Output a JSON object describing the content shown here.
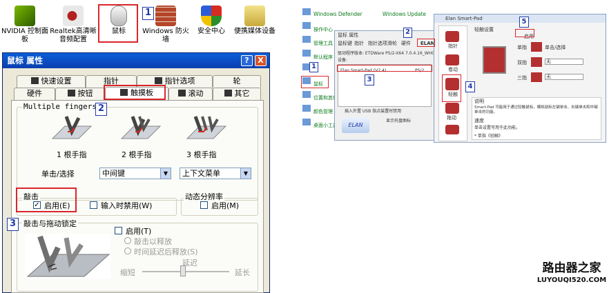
{
  "control_panel": {
    "items": [
      {
        "label": "NVIDIA 控制面板",
        "icon": "nvidia-icon"
      },
      {
        "label": "Realtek高清晰音频配置",
        "icon": "speaker-icon"
      },
      {
        "label": "鼠标",
        "icon": "mouse-icon"
      },
      {
        "label": "Windows 防火墙",
        "icon": "firewall-icon"
      },
      {
        "label": "安全中心",
        "icon": "shield-icon"
      },
      {
        "label": "便携媒体设备",
        "icon": "media-device-icon"
      }
    ]
  },
  "mouse_dialog": {
    "title": "鼠标 属性",
    "help_button": "?",
    "close_button": "X",
    "tabs_row1": [
      "快速设置",
      "指针",
      "指针选项",
      "轮"
    ],
    "tabs_row2": [
      "硬件",
      "按钮",
      "触摸板",
      "滚动",
      "其它"
    ],
    "multiple_fingers": {
      "title": "Multiple fingers",
      "finger_labels": [
        "1 根手指",
        "2 根手指",
        "3 根手指"
      ],
      "click_select_label": "单击/选择",
      "select1_value": "中间键",
      "select2_value": "上下文菜单"
    },
    "tap": {
      "title": "敲击",
      "enable_label": "启用(E)",
      "enable_checked": true,
      "disable_while_typing_label": "输入时禁用(W)"
    },
    "dynamic_resolution": {
      "title": "动态分辨率",
      "enable_label": "启用(M)"
    },
    "tap_drag": {
      "title": "敲击与拖动锁定",
      "enable_label": "启用(T)",
      "option1": "敲击以释放",
      "option2": "时间延迟后释放(S)",
      "delay_label": "延迟",
      "short_label": "缩短",
      "long_label": "延长"
    }
  },
  "screenshot2": {
    "cp_items": [
      "Windows Defender",
      "Windows Update",
      "操作中心",
      "管理工具",
      "默认程序",
      "鼠标",
      "位置和其他传感器",
      "颜色管理",
      "桌面小工具"
    ],
    "mouse_props_title": "鼠标 属性",
    "tabs": [
      "鼠标键",
      "指针",
      "指针选项",
      "滑轮",
      "硬件",
      "ELAN"
    ],
    "driver_label": "驱动程序版本: ETDWare PS/2-X64 7.0.4.16_WHQL",
    "device_label": "设备:",
    "device_row": "Elan Smart-Pad (V2.4)",
    "device_port": "PS/2",
    "insert_usb_label": "插入外置 USB 指点装置时禁用",
    "show_tray_icon": "显示托盘图标",
    "elan_title": "Elan Smart-Pad",
    "elan_sidebar": [
      "指针",
      "卷动",
      "轻触",
      "拖动",
      "手势"
    ],
    "tap_settings_title": "轻触设置",
    "enable_label": "启用",
    "single_tap": "单指",
    "single_tap_value": "单击/选择",
    "double_tap": "双指",
    "double_tap_value": "无",
    "triple_tap": "三指",
    "triple_tap_value": "无",
    "description_title": "说明",
    "description_text": "Smart-Pad 可能用于通过轻触鼠标，模拟鼠标左键单击、右键单击和中键单击的功能。",
    "speed_title": "速度",
    "speed_text": "单击设置可用于此功能。",
    "note_text": "* 单指《轻触》"
  },
  "watermark": {
    "title": "路由器之家",
    "url": "LUYOUQI520.COM"
  },
  "step_numbers": [
    "1",
    "2",
    "3",
    "1",
    "2",
    "3",
    "4",
    "5"
  ]
}
